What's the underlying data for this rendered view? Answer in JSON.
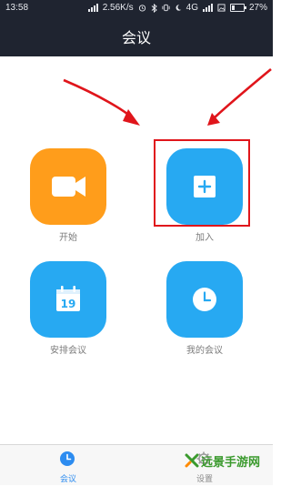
{
  "status_bar": {
    "time": "13:58",
    "speed": "2.56K/s",
    "network": "4G",
    "battery": "27%"
  },
  "header": {
    "title": "会议"
  },
  "actions": [
    {
      "label": "开始",
      "icon": "video-camera-icon",
      "color": "#ff9d1b"
    },
    {
      "label": "加入",
      "icon": "plus-box-icon",
      "color": "#27a9f2"
    },
    {
      "label": "安排会议",
      "icon": "calendar-icon",
      "color": "#27a9f2"
    },
    {
      "label": "我的会议",
      "icon": "clock-icon",
      "color": "#27a9f2"
    }
  ],
  "tabbar": {
    "tabs": [
      {
        "label": "会议",
        "icon": "clock-icon",
        "active": true
      },
      {
        "label": "设置",
        "icon": "gear-icon",
        "active": false
      }
    ]
  },
  "calendar_day": "19",
  "watermark": {
    "text": "远景手游网"
  },
  "colors": {
    "accent": "#2d8cf0",
    "header_bg": "#1f2430",
    "highlight": "#e0151b"
  }
}
